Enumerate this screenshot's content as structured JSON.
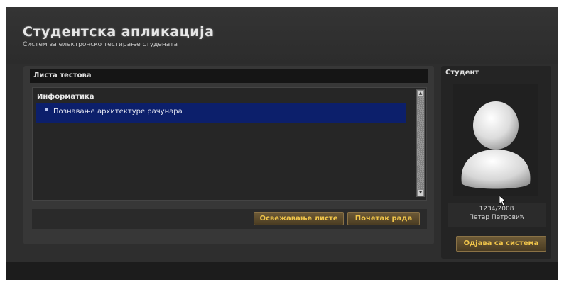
{
  "app": {
    "title": "Студентска апликација",
    "subtitle": "Систем за електронско тестирање студената"
  },
  "tests_panel": {
    "header": "Листа тестова",
    "category": "Информатика",
    "items": [
      {
        "label": "Познавање архитектуре рачунара",
        "selected": true
      }
    ],
    "buttons": {
      "refresh": "Освежавање листе",
      "start": "Почетак рада"
    }
  },
  "student_panel": {
    "header": "Студент",
    "student_id": "1234/2008",
    "student_name": "Петар Петровић",
    "logout": "Одјава са система"
  },
  "colors": {
    "background": "#2e2e2e",
    "selection": "#0c1f6b",
    "button_text": "#f0c54a"
  },
  "icons": [
    "user-avatar-icon",
    "scroll-up-icon",
    "scroll-down-icon",
    "mouse-cursor-icon"
  ]
}
